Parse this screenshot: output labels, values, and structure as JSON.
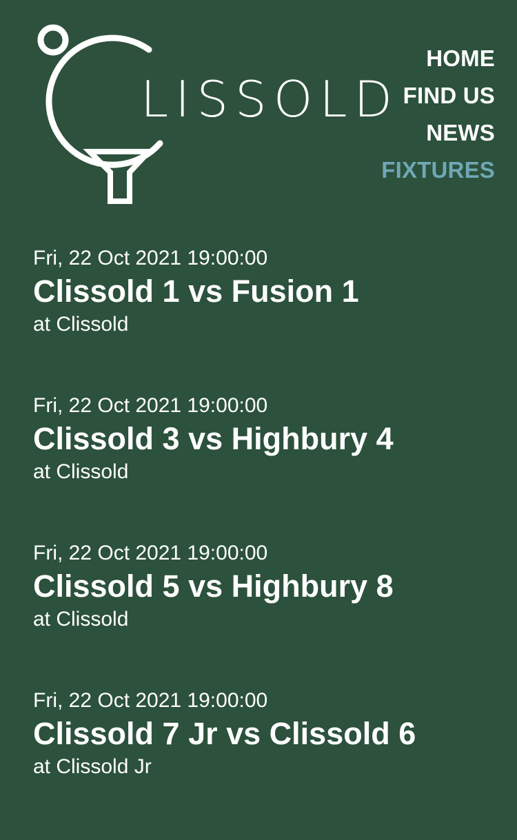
{
  "logo": {
    "text": "LISSOLD"
  },
  "nav": {
    "items": [
      {
        "label": "HOME",
        "active": false
      },
      {
        "label": "FIND US",
        "active": false
      },
      {
        "label": "NEWS",
        "active": false
      },
      {
        "label": "FIXTURES",
        "active": true
      }
    ]
  },
  "fixtures": [
    {
      "date": "Fri, 22 Oct 2021 19:00:00",
      "title": "Clissold 1 vs Fusion 1",
      "venue": "at Clissold"
    },
    {
      "date": "Fri, 22 Oct 2021 19:00:00",
      "title": "Clissold 3 vs Highbury 4",
      "venue": "at Clissold"
    },
    {
      "date": "Fri, 22 Oct 2021 19:00:00",
      "title": "Clissold 5 vs Highbury 8",
      "venue": "at Clissold"
    },
    {
      "date": "Fri, 22 Oct 2021 19:00:00",
      "title": "Clissold 7 Jr vs Clissold 6",
      "venue": "at Clissold Jr"
    }
  ],
  "colors": {
    "background": "#2c513c",
    "text": "#ffffff",
    "nav_active": "#6fa7b5"
  }
}
